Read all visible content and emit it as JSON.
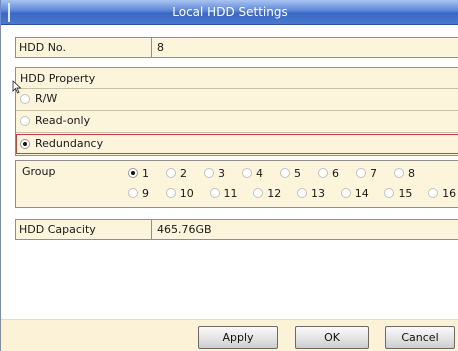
{
  "window": {
    "title": "Local HDD Settings"
  },
  "hdd_no": {
    "label": "HDD No.",
    "value": "8"
  },
  "hdd_property": {
    "heading": "HDD Property",
    "options": [
      {
        "label": "R/W",
        "checked": false
      },
      {
        "label": "Read-only",
        "checked": false
      },
      {
        "label": "Redundancy",
        "checked": true
      }
    ]
  },
  "group": {
    "label": "Group",
    "selected": "1",
    "options": [
      "1",
      "2",
      "3",
      "4",
      "5",
      "6",
      "7",
      "8",
      "9",
      "10",
      "11",
      "12",
      "13",
      "14",
      "15",
      "16"
    ]
  },
  "hdd_capacity": {
    "label": "HDD Capacity",
    "value": "465.76GB"
  },
  "buttons": {
    "apply": "Apply",
    "ok": "OK",
    "cancel": "Cancel"
  },
  "colors": {
    "title_bar": "#4a78cf",
    "panel_background": "#fdf4dc",
    "highlight_border": "#d23a3a"
  }
}
